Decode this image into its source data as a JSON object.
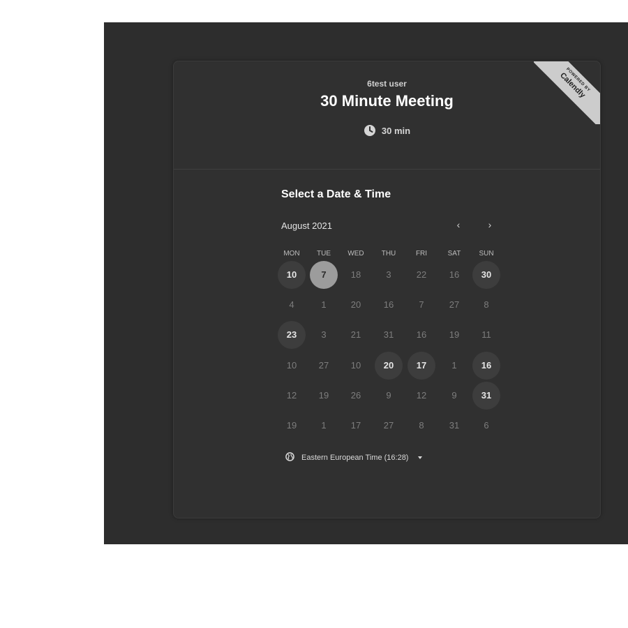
{
  "header": {
    "user_name": "6test user",
    "event_title": "30 Minute Meeting",
    "duration": "30 min",
    "duration_icon": "clock-icon"
  },
  "badge": {
    "powered_by": "POWERED BY",
    "brand": "Calendly"
  },
  "calendar": {
    "heading": "Select a Date & Time",
    "month_label": "August 2021",
    "prev_icon": "‹",
    "next_icon": "›",
    "weekdays": [
      "MON",
      "TUE",
      "WED",
      "THU",
      "FRI",
      "SAT",
      "SUN"
    ],
    "weeks": [
      [
        {
          "d": "10",
          "s": "available"
        },
        {
          "d": "7",
          "s": "selected"
        },
        {
          "d": "18",
          "s": "disabled"
        },
        {
          "d": "3",
          "s": "disabled"
        },
        {
          "d": "22",
          "s": "disabled"
        },
        {
          "d": "16",
          "s": "disabled"
        },
        {
          "d": "30",
          "s": "available"
        }
      ],
      [
        {
          "d": "4",
          "s": "disabled"
        },
        {
          "d": "1",
          "s": "disabled"
        },
        {
          "d": "20",
          "s": "disabled"
        },
        {
          "d": "16",
          "s": "disabled"
        },
        {
          "d": "7",
          "s": "disabled"
        },
        {
          "d": "27",
          "s": "disabled"
        },
        {
          "d": "8",
          "s": "disabled"
        }
      ],
      [
        {
          "d": "23",
          "s": "available"
        },
        {
          "d": "3",
          "s": "disabled"
        },
        {
          "d": "21",
          "s": "disabled"
        },
        {
          "d": "31",
          "s": "disabled"
        },
        {
          "d": "16",
          "s": "disabled"
        },
        {
          "d": "19",
          "s": "disabled"
        },
        {
          "d": "11",
          "s": "disabled"
        }
      ],
      [
        {
          "d": "10",
          "s": "disabled"
        },
        {
          "d": "27",
          "s": "disabled"
        },
        {
          "d": "10",
          "s": "disabled"
        },
        {
          "d": "20",
          "s": "available"
        },
        {
          "d": "17",
          "s": "available"
        },
        {
          "d": "1",
          "s": "disabled"
        },
        {
          "d": "16",
          "s": "available"
        }
      ],
      [
        {
          "d": "12",
          "s": "disabled"
        },
        {
          "d": "19",
          "s": "disabled"
        },
        {
          "d": "26",
          "s": "disabled"
        },
        {
          "d": "9",
          "s": "disabled"
        },
        {
          "d": "12",
          "s": "disabled"
        },
        {
          "d": "9",
          "s": "disabled"
        },
        {
          "d": "31",
          "s": "available"
        }
      ],
      [
        {
          "d": "19",
          "s": "disabled"
        },
        {
          "d": "1",
          "s": "disabled"
        },
        {
          "d": "17",
          "s": "disabled"
        },
        {
          "d": "27",
          "s": "disabled"
        },
        {
          "d": "8",
          "s": "disabled"
        },
        {
          "d": "31",
          "s": "disabled"
        },
        {
          "d": "6",
          "s": "disabled"
        }
      ]
    ]
  },
  "timezone": {
    "label": "Eastern European Time (16:28)",
    "icon": "globe-icon"
  },
  "colors": {
    "backdrop": "#2d2d2d",
    "card": "#303030",
    "selected": "#9c9c9c",
    "available": "#3d3d3d"
  }
}
